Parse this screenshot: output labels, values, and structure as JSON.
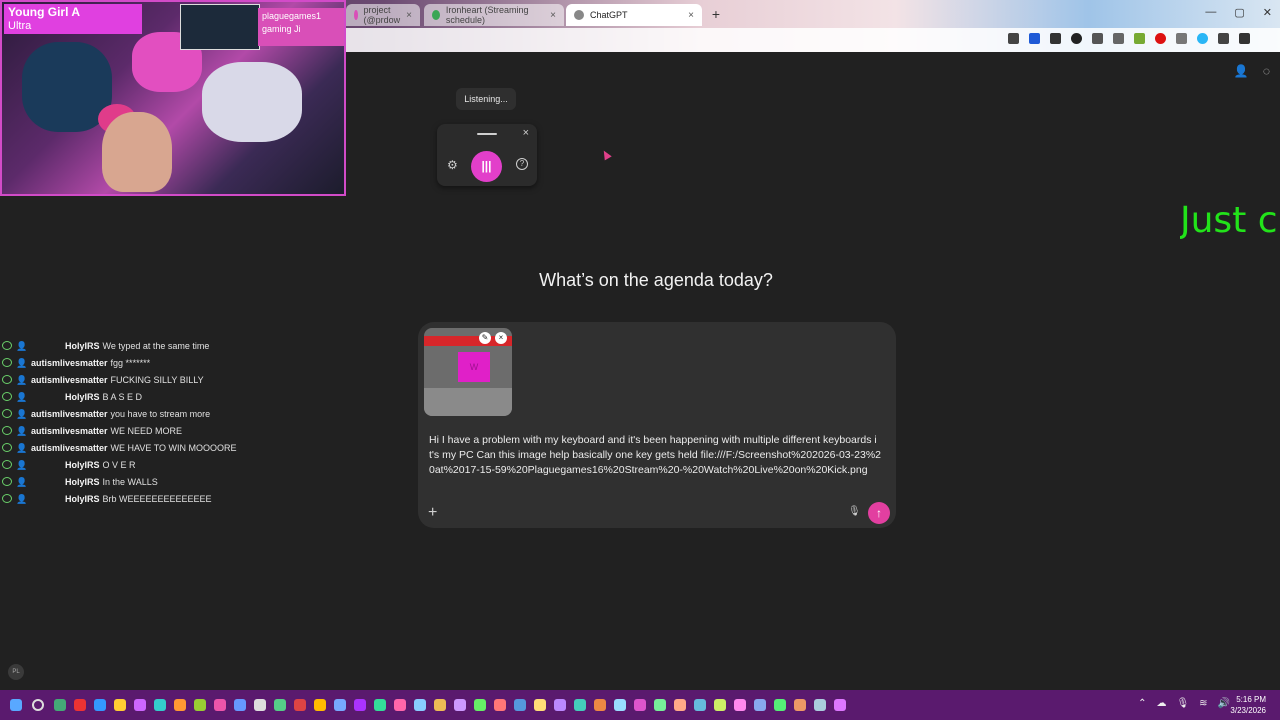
{
  "browser": {
    "tabs": [
      {
        "label": "project (@prdow",
        "favicon_color": "#d94fb8"
      },
      {
        "label": "Ironheart (Streaming schedule)",
        "favicon_color": "#3aa655"
      },
      {
        "label": "ChatGPT",
        "favicon_color": "#888888"
      }
    ],
    "new_tab": "+",
    "close": "×",
    "window_controls": {
      "minimize": "—",
      "maximize": "▢",
      "close": "✕"
    }
  },
  "stream_overlay": {
    "title_line1": "Young Girl A",
    "title_line2": "Ultra",
    "youtube_text": "plaguegames1 gaming Ji"
  },
  "voice": {
    "status": "Listening...",
    "close": "×",
    "settings_icon": "gear-icon",
    "pause_label": "|||",
    "help_label": "?"
  },
  "overlay_text": "Just ch",
  "chatgpt": {
    "heading": "What’s on the agenda today?",
    "attachment": {
      "thumb_letter": "W",
      "edit": "✎",
      "remove": "×"
    },
    "prompt": "Hi I have a problem with my keyboard and it's been happening with multiple different keyboards it's my PC Can this image help basically one key gets held file:///F:/Screenshot%202026-03-23%20at%2017-15-59%20Plaguegames16%20Stream%20-%20Watch%20Live%20on%20Kick.png",
    "plus": "+",
    "mic": "🎙",
    "send": "↑"
  },
  "chat": [
    {
      "user": "HolyIRS",
      "message": "We typed at the same time",
      "indent": true
    },
    {
      "user": "autismlivesmatter",
      "message": "fgg *******",
      "indent": false
    },
    {
      "user": "autismlivesmatter",
      "message": "FUCKING SILLY BILLY",
      "indent": false
    },
    {
      "user": "HolyIRS",
      "message": "B A S E D",
      "indent": true
    },
    {
      "user": "autismlivesmatter",
      "message": "you have to stream more",
      "indent": false
    },
    {
      "user": "autismlivesmatter",
      "message": "WE NEED MORE",
      "indent": false
    },
    {
      "user": "autismlivesmatter",
      "message": "WE HAVE TO WIN MOOOORE",
      "indent": false
    },
    {
      "user": "HolyIRS",
      "message": "O V E R",
      "indent": true
    },
    {
      "user": "HolyIRS",
      "message": "In the WALLS",
      "indent": true
    },
    {
      "user": "HolyIRS",
      "message": "Brb WEEEEEEEEEEEEEE",
      "indent": true
    }
  ],
  "corner_avatar": "PL",
  "taskbar": {
    "time": "5:16 PM",
    "date": "3/23/2026"
  }
}
